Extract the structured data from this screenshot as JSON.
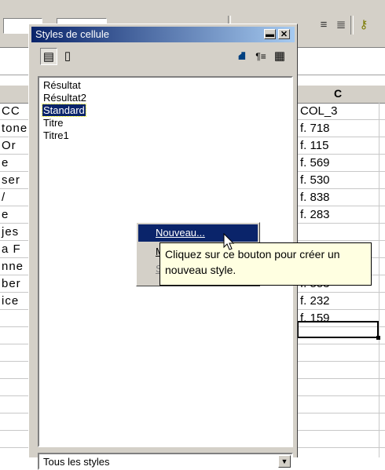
{
  "spreadsheet": {
    "column_header": "C",
    "left_cells": [
      "CC",
      "tone",
      "Or",
      "e",
      "ser",
      "/",
      "e",
      "jes",
      "a F",
      "nne",
      "ber",
      "ice"
    ],
    "c_cells": [
      "COL_3",
      "f. 718",
      "f. 115",
      "f. 569",
      "f. 530",
      "f. 838",
      "f. 283",
      "",
      "",
      "f. 553",
      "f. 232",
      "f. 159"
    ]
  },
  "window": {
    "title": "Styles de cellule",
    "styles": [
      "Résultat",
      "Résultat2",
      "Standard",
      "Titre",
      "Titre1"
    ],
    "selected_style": "Standard",
    "filter": "Tous les styles"
  },
  "context_menu": {
    "items": [
      {
        "label": "Nouveau...",
        "underline": "N",
        "highlighted": true
      },
      {
        "label": "M",
        "underline": "M",
        "highlighted": false
      },
      {
        "label": "S",
        "underline": "S",
        "highlighted": false,
        "disabled": true
      }
    ]
  },
  "tooltip": {
    "line1": "Cliquez sur ce bouton pour créer un",
    "line2": "nouveau style."
  },
  "icons": {
    "toolbar": [
      "align-justify-icon",
      "align-list-icon",
      "key-icon"
    ],
    "window_tools": [
      "paragraph-styles-icon",
      "page-styles-icon",
      "fill-format-icon",
      "new-style-icon",
      "update-style-icon"
    ]
  }
}
